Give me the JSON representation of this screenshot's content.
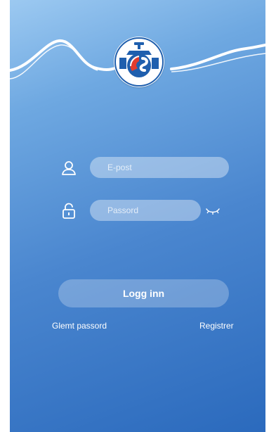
{
  "app": {
    "logo_icon": "water-pump-valve-logo"
  },
  "login_form": {
    "email_placeholder": "E-post",
    "email_value": "",
    "email_icon": "user-icon",
    "password_placeholder": "Passord",
    "password_value": "",
    "password_icon": "unlock-icon",
    "password_toggle_icon": "eye-closed-icon",
    "login_label": "Logg inn",
    "forgot_password_label": "Glemt passord",
    "register_label": "Registrer"
  },
  "colors": {
    "background_top": "#9cc9f1",
    "background_bottom": "#2b6abd",
    "logo_red": "#e23b2e",
    "logo_blue": "#1f5fae"
  }
}
